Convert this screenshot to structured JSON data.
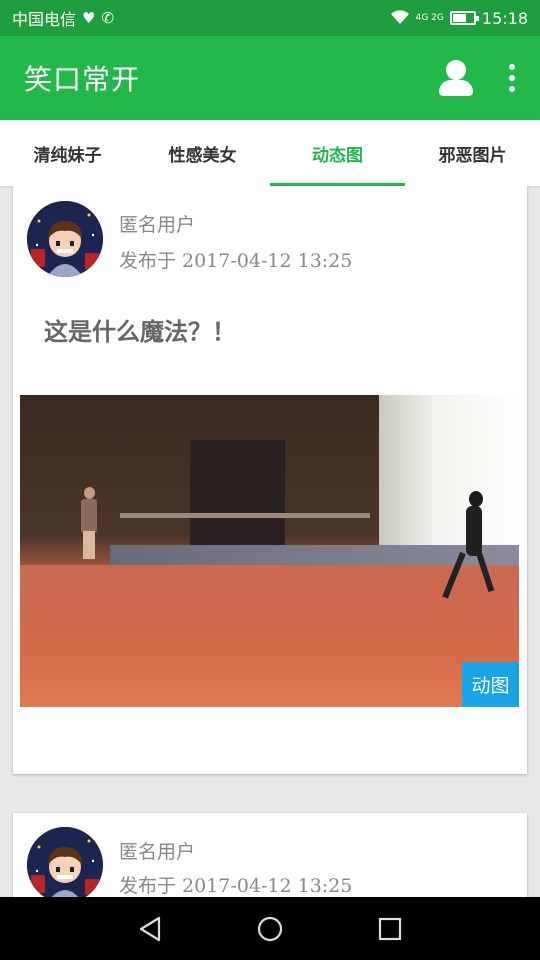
{
  "status_bar": {
    "carrier": "中国电信",
    "network": "4G 2G",
    "time": "15:18",
    "battery_level": 0.6
  },
  "app_bar": {
    "title": "笑口常开",
    "icons": [
      "user-icon",
      "more-vertical-icon"
    ]
  },
  "tabs": [
    {
      "label": "清纯妹子",
      "active": false
    },
    {
      "label": "性感美女",
      "active": false
    },
    {
      "label": "动态图",
      "active": true
    },
    {
      "label": "邪恶图片",
      "active": false
    }
  ],
  "posts": [
    {
      "user_name": "匿名用户",
      "published": "发布于 2017-04-12 13:25",
      "title": "这是什么魔法？！",
      "media_badge": "动图"
    },
    {
      "user_name": "匿名用户",
      "published": "发布于 2017-04-12 13:25"
    }
  ],
  "colors": {
    "status_bar": "#1e9e3f",
    "app_bar": "#22b84a",
    "accent": "#22b84a",
    "badge": "#1aa4e8"
  },
  "nav_bar": {
    "icons": [
      "back-triangle-icon",
      "home-circle-icon",
      "recents-square-icon"
    ]
  }
}
